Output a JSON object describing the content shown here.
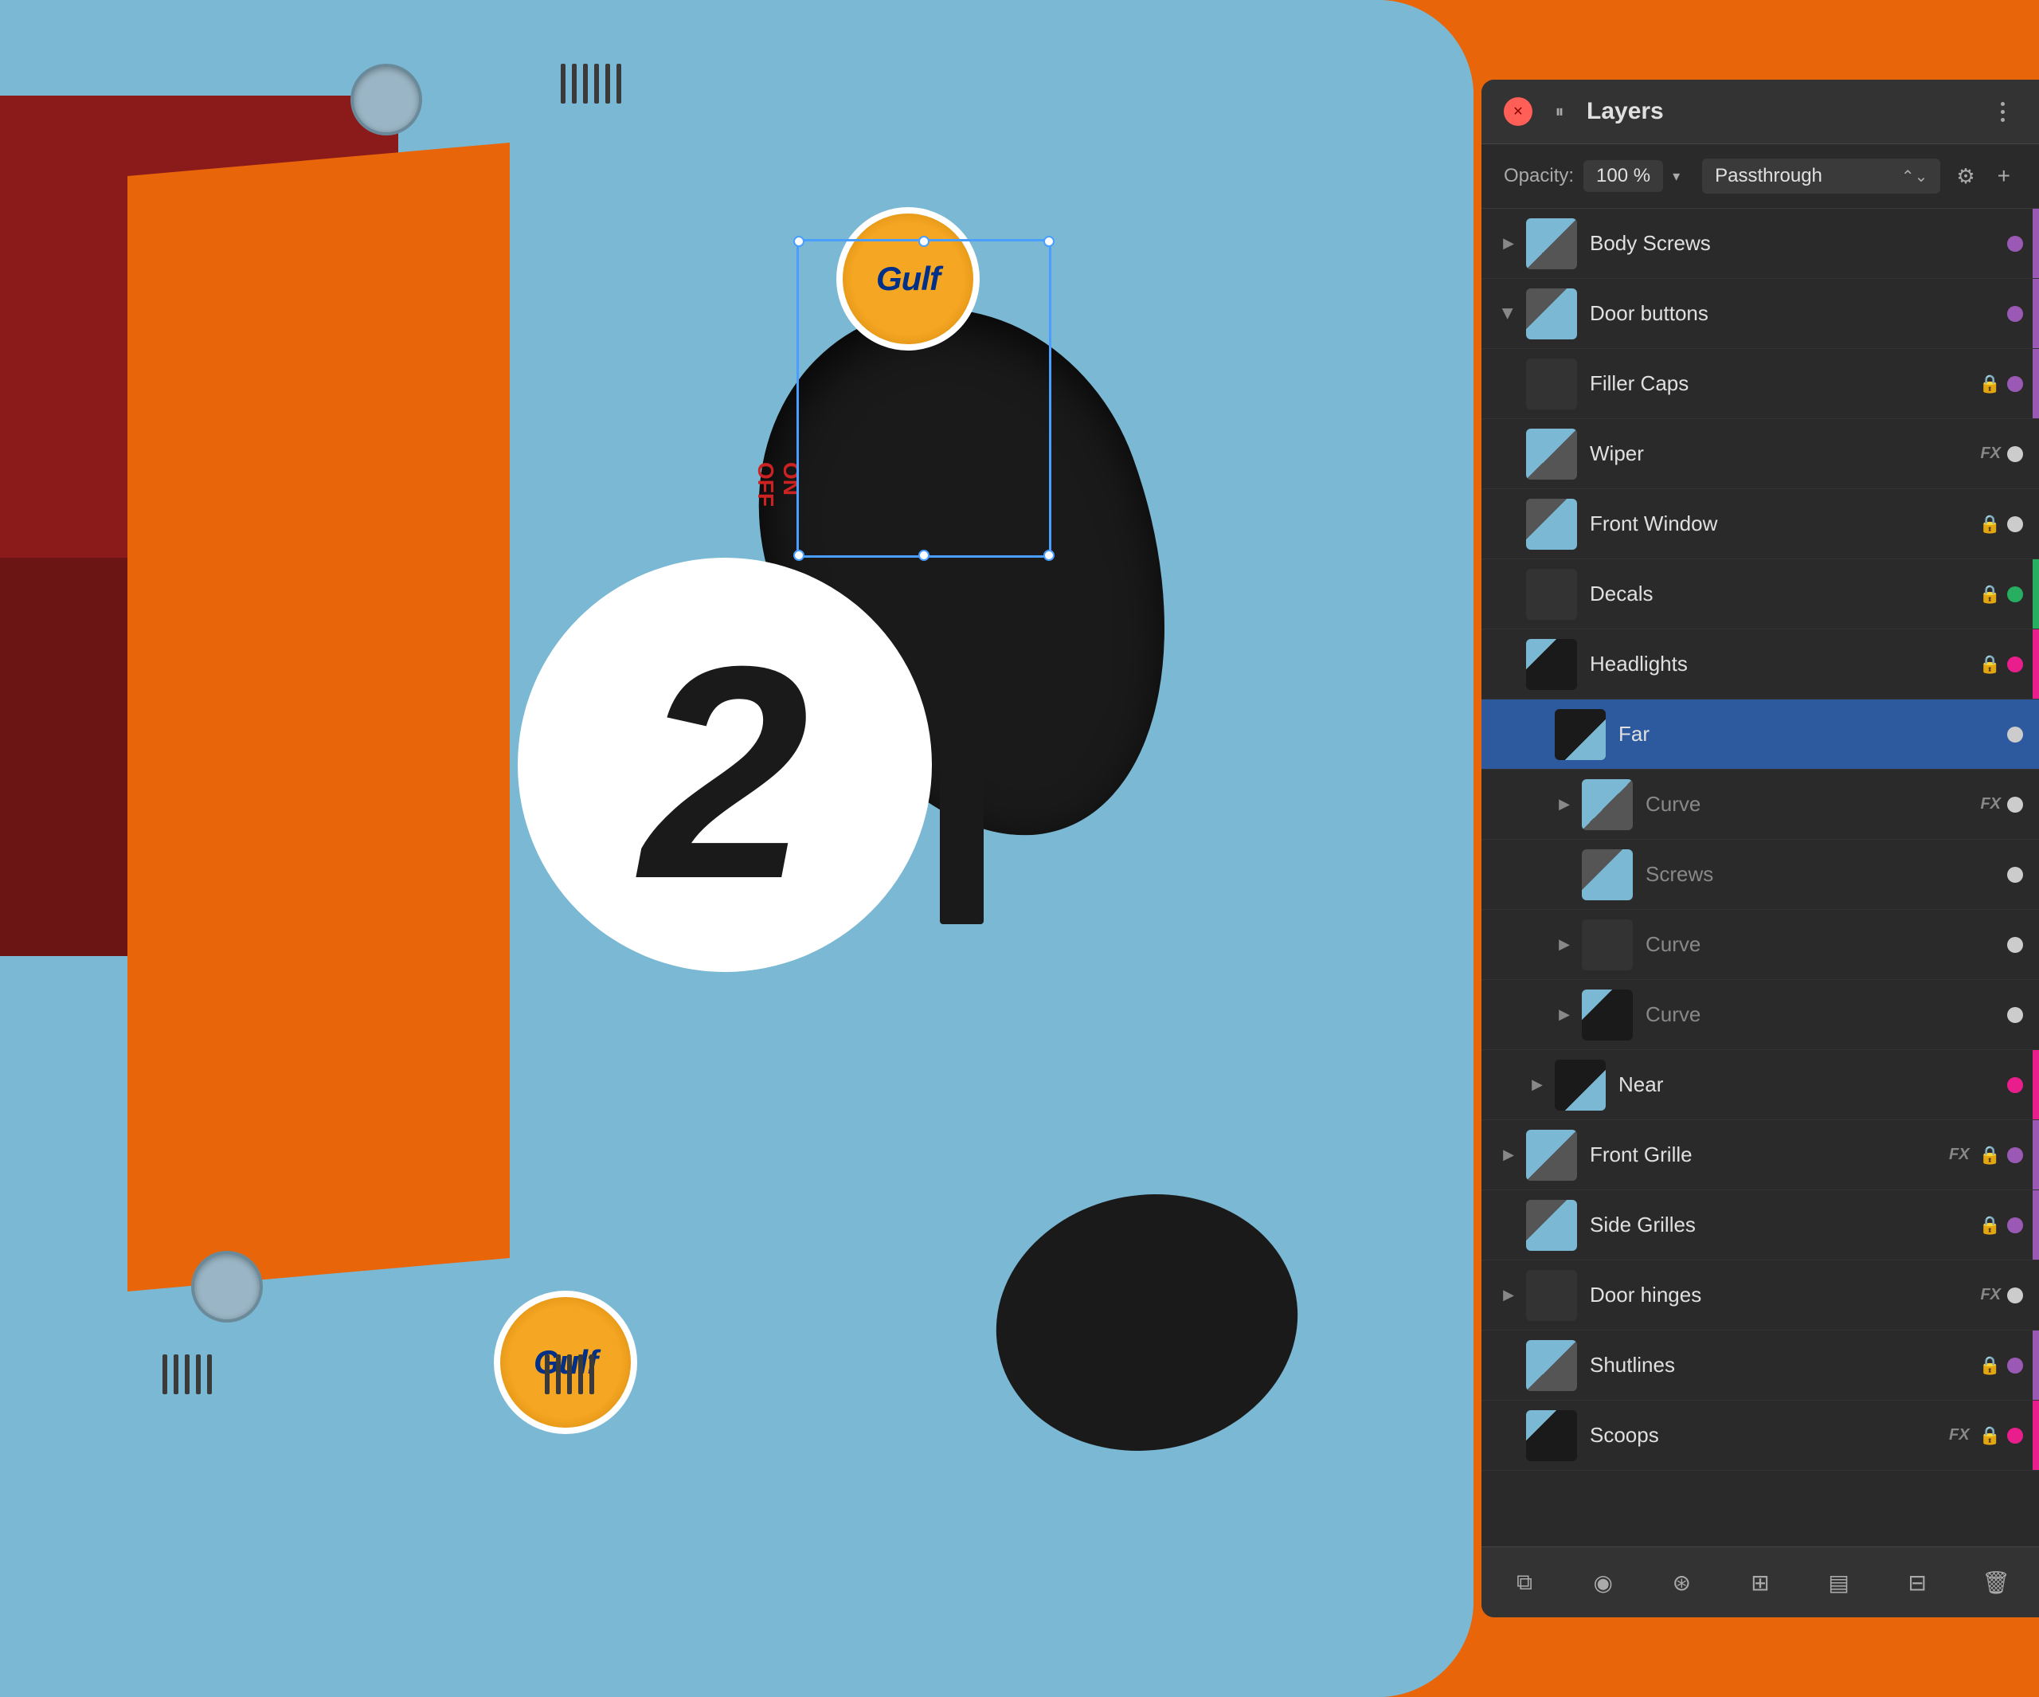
{
  "panel": {
    "title": "Layers",
    "close_label": "×",
    "pause_label": "||",
    "menu_label": "⋮",
    "opacity_label": "Opacity:",
    "opacity_value": "100 %",
    "blend_mode": "Passthrough",
    "layers": [
      {
        "id": "body-screws",
        "name": "Body Screws",
        "indent": 0,
        "expandable": true,
        "expanded": false,
        "has_fx": false,
        "has_lock": false,
        "vis_color": "purple",
        "thumb_class": "thumb-car-1"
      },
      {
        "id": "door-buttons",
        "name": "Door buttons",
        "indent": 0,
        "expandable": true,
        "expanded": true,
        "has_fx": false,
        "has_lock": false,
        "vis_color": "purple",
        "thumb_class": "thumb-car-2"
      },
      {
        "id": "filler-caps",
        "name": "Filler Caps",
        "indent": 0,
        "expandable": false,
        "expanded": false,
        "has_fx": false,
        "has_lock": true,
        "vis_color": "purple",
        "thumb_class": "thumb-car-3"
      },
      {
        "id": "wiper",
        "name": "Wiper",
        "indent": 0,
        "expandable": false,
        "expanded": false,
        "has_fx": true,
        "has_lock": false,
        "vis_color": "visible",
        "thumb_class": "thumb-car-1"
      },
      {
        "id": "front-window",
        "name": "Front Window",
        "indent": 0,
        "expandable": false,
        "expanded": false,
        "has_fx": false,
        "has_lock": true,
        "vis_color": "visible",
        "thumb_class": "thumb-car-2"
      },
      {
        "id": "decals",
        "name": "Decals",
        "indent": 0,
        "expandable": false,
        "expanded": false,
        "has_fx": false,
        "has_lock": true,
        "vis_color": "green",
        "thumb_class": "thumb-car-3"
      },
      {
        "id": "headlights",
        "name": "Headlights",
        "indent": 0,
        "expandable": false,
        "expanded": true,
        "has_fx": false,
        "has_lock": true,
        "vis_color": "pink",
        "thumb_class": "thumb-car-4"
      },
      {
        "id": "far",
        "name": "Far",
        "indent": 1,
        "expandable": false,
        "expanded": false,
        "selected": true,
        "has_fx": false,
        "has_lock": false,
        "vis_color": "visible",
        "thumb_class": "thumb-car-5"
      },
      {
        "id": "curve-1",
        "name": "Curve",
        "indent": 2,
        "expandable": true,
        "expanded": false,
        "dimmed": true,
        "has_fx": true,
        "has_lock": false,
        "vis_color": "visible",
        "thumb_class": "thumb-car-1"
      },
      {
        "id": "screws",
        "name": "Screws",
        "indent": 2,
        "expandable": false,
        "expanded": false,
        "dimmed": true,
        "has_fx": false,
        "has_lock": false,
        "vis_color": "visible",
        "thumb_class": "thumb-car-2"
      },
      {
        "id": "curve-2",
        "name": "Curve",
        "indent": 2,
        "expandable": true,
        "expanded": false,
        "dimmed": true,
        "has_fx": false,
        "has_lock": false,
        "vis_color": "visible",
        "thumb_class": "thumb-car-3"
      },
      {
        "id": "curve-3",
        "name": "Curve",
        "indent": 2,
        "expandable": true,
        "expanded": false,
        "dimmed": true,
        "has_fx": false,
        "has_lock": false,
        "vis_color": "visible",
        "thumb_class": "thumb-car-4"
      },
      {
        "id": "near",
        "name": "Near",
        "indent": 1,
        "expandable": true,
        "expanded": false,
        "has_fx": false,
        "has_lock": false,
        "vis_color": "pink",
        "thumb_class": "thumb-car-5"
      },
      {
        "id": "front-grille",
        "name": "Front Grille",
        "indent": 0,
        "expandable": true,
        "expanded": false,
        "has_fx": true,
        "has_lock": true,
        "vis_color": "purple",
        "thumb_class": "thumb-car-1"
      },
      {
        "id": "side-grilles",
        "name": "Side Grilles",
        "indent": 0,
        "expandable": false,
        "expanded": false,
        "has_fx": false,
        "has_lock": true,
        "vis_color": "purple",
        "thumb_class": "thumb-car-2"
      },
      {
        "id": "door-hinges",
        "name": "Door hinges",
        "indent": 0,
        "expandable": true,
        "expanded": false,
        "has_fx": true,
        "has_lock": false,
        "vis_color": "visible",
        "thumb_class": "thumb-car-3"
      },
      {
        "id": "shutlines",
        "name": "Shutlines",
        "indent": 0,
        "expandable": false,
        "expanded": false,
        "has_fx": false,
        "has_lock": true,
        "vis_color": "purple",
        "thumb_class": "thumb-car-1"
      },
      {
        "id": "scoops",
        "name": "Scoops",
        "indent": 0,
        "expandable": false,
        "expanded": false,
        "has_fx": true,
        "has_lock": true,
        "vis_color": "pink",
        "thumb_class": "thumb-car-4"
      }
    ],
    "toolbar_buttons": [
      {
        "id": "duplicate",
        "icon": "⧉",
        "label": "duplicate"
      },
      {
        "id": "mask",
        "icon": "◉",
        "label": "mask"
      },
      {
        "id": "fx",
        "icon": "⊛",
        "label": "fx"
      },
      {
        "id": "adjustment",
        "icon": "⊞",
        "label": "adjustment"
      },
      {
        "id": "group",
        "icon": "▤",
        "label": "group"
      },
      {
        "id": "grid",
        "icon": "⊟",
        "label": "grid"
      },
      {
        "id": "delete",
        "icon": "🗑",
        "label": "delete"
      }
    ]
  },
  "car": {
    "number": "2",
    "brand": "Gulf"
  }
}
